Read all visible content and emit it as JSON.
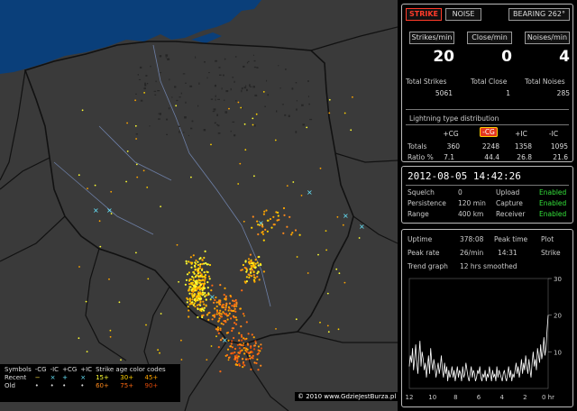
{
  "map": {
    "copyright": "© 2010 www.GdzieJestBurza.pl",
    "colors": {
      "land": "#3a3a3a",
      "sea": "#0a3f7a",
      "border": "#101010",
      "river": "#6d7fa6"
    }
  },
  "legend": {
    "title_symbols": "Symbols",
    "sym_headers": [
      "-CG",
      "-IC",
      "+CG",
      "+IC"
    ],
    "title_age": "Strike age color codes",
    "rows": [
      {
        "label": "Recent",
        "symbols": [
          "−",
          "×",
          "+",
          "×"
        ],
        "ages": [
          "15+",
          "30+",
          "45+"
        ]
      },
      {
        "label": "Old",
        "symbols": [
          "•",
          "•",
          "•",
          "•"
        ],
        "ages": [
          "60+",
          "75+",
          "90+"
        ]
      }
    ]
  },
  "panel": {
    "buttons": {
      "strike": "STRIKE",
      "noise": "NOISE",
      "bearing": "BEARING 262°"
    },
    "rates": {
      "strikes_min_label": "Strikes/min",
      "strikes_min": "20",
      "close_min_label": "Close/min",
      "close_min": "0",
      "noises_min_label": "Noises/min",
      "noises_min": "4"
    },
    "totals": {
      "total_strikes_label": "Total Strikes",
      "total_strikes": "5061",
      "total_close_label": "Total Close",
      "total_close": "1",
      "total_noises_label": "Total Noises",
      "total_noises": "285"
    },
    "distribution": {
      "title": "Lightning type distribution",
      "headers": [
        "+CG",
        "-CG",
        "+IC",
        "-IC"
      ],
      "totals_label": "Totals",
      "totals": [
        "360",
        "2248",
        "1358",
        "1095"
      ],
      "ratio_label": "Ratio %",
      "ratio": [
        "7.1",
        "44.4",
        "26.8",
        "21.6"
      ]
    },
    "status": {
      "datetime": "2012-08-05 14:42:26",
      "squelch_label": "Squelch",
      "squelch": "0",
      "persistence_label": "Persistence",
      "persistence": "120 min",
      "range_label": "Range",
      "range": "400 km",
      "upload_label": "Upload",
      "upload": "Enabled",
      "capture_label": "Capture",
      "capture": "Enabled",
      "receiver_label": "Receiver",
      "receiver": "Enabled"
    },
    "stats": {
      "uptime_label": "Uptime",
      "uptime": "378:08",
      "peak_time_label": "Peak time",
      "peak_time": "14:31",
      "plot_label": "Plot",
      "plot": "Strike",
      "peak_rate_label": "Peak rate",
      "peak_rate": "26/min",
      "trend_label": "Trend graph",
      "trend": "12 hrs smoothed"
    },
    "trend_graph": {
      "y_ticks": [
        "30",
        "20",
        "10"
      ],
      "x_ticks": [
        "12",
        "10",
        "8",
        "6",
        "4",
        "2",
        "0 hr"
      ],
      "values": [
        6,
        9,
        7,
        11,
        5,
        8,
        12,
        7,
        4,
        9,
        13,
        6,
        10,
        8,
        5,
        7,
        3,
        6,
        9,
        4,
        11,
        7,
        5,
        8,
        6,
        3,
        5,
        7,
        4,
        6,
        9,
        5,
        3,
        7,
        4,
        6,
        2,
        5,
        3,
        4,
        6,
        3,
        5,
        2,
        4,
        6,
        3,
        5,
        4,
        2,
        6,
        3,
        4,
        7,
        5,
        3,
        2,
        4,
        6,
        3,
        5,
        4,
        2,
        3,
        5,
        4,
        6,
        3,
        2,
        4,
        3,
        5,
        2,
        4,
        3,
        6,
        4,
        2,
        5,
        3,
        4,
        2,
        6,
        3,
        5,
        4,
        3,
        2,
        4,
        5,
        3,
        2,
        4,
        6,
        3,
        5,
        2,
        4,
        3,
        5,
        7,
        4,
        6,
        3,
        5,
        8,
        4,
        7,
        5,
        9,
        6,
        4,
        8,
        5,
        3,
        7,
        10,
        6,
        8,
        5,
        11,
        9,
        7,
        12,
        8,
        10,
        14,
        9,
        11,
        16,
        20
      ]
    }
  }
}
